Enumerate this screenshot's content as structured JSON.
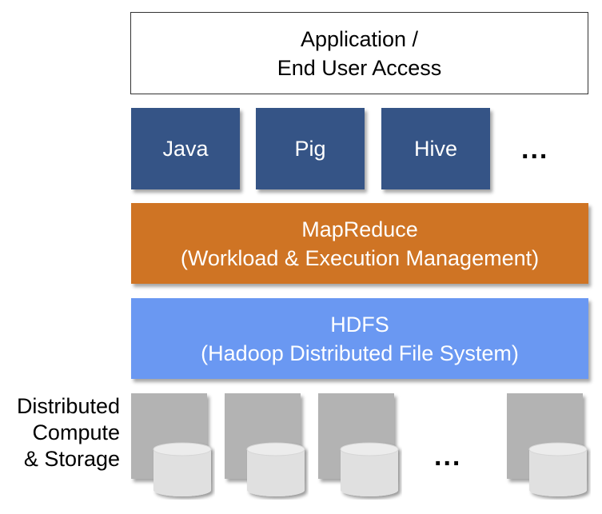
{
  "top_box": {
    "line1": "Application /",
    "line2": "End User Access"
  },
  "tools": [
    {
      "label": "Java"
    },
    {
      "label": "Pig"
    },
    {
      "label": "Hive"
    }
  ],
  "tools_more": "...",
  "mapreduce": {
    "line1": "MapReduce",
    "line2": "(Workload & Execution Management)",
    "color": "#CF7424"
  },
  "hdfs": {
    "line1": "HDFS",
    "line2": "(Hadoop Distributed File System)",
    "color": "#6A98F2"
  },
  "tool_color": "#355486",
  "storage_label": {
    "line1": "Distributed",
    "line2": "Compute",
    "line3": "& Storage"
  },
  "nodes_more": "...",
  "node_count_shown": 4
}
